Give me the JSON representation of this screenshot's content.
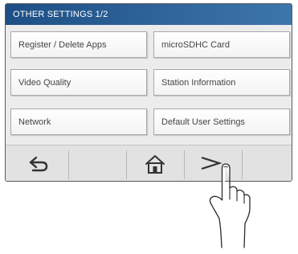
{
  "header": {
    "title": "OTHER SETTINGS  1/2"
  },
  "menu": {
    "register_delete_apps": "Register / Delete Apps",
    "microsdhc_card": "microSDHC Card",
    "video_quality": "Video Quality",
    "station_information": "Station Information",
    "network": "Network",
    "default_user_settings": "Default User Settings"
  },
  "nav": {
    "back_icon": "return-arrow-icon",
    "home_icon": "home-icon",
    "next_icon": "chevron-right-icon"
  },
  "overlay": {
    "pointer_icon": "pointing-hand-icon"
  },
  "colors": {
    "header_start": "#1d4f84",
    "header_end": "#3d76ac",
    "grid_background": "#ececec",
    "bottom_bar": "#e2e2e2"
  }
}
